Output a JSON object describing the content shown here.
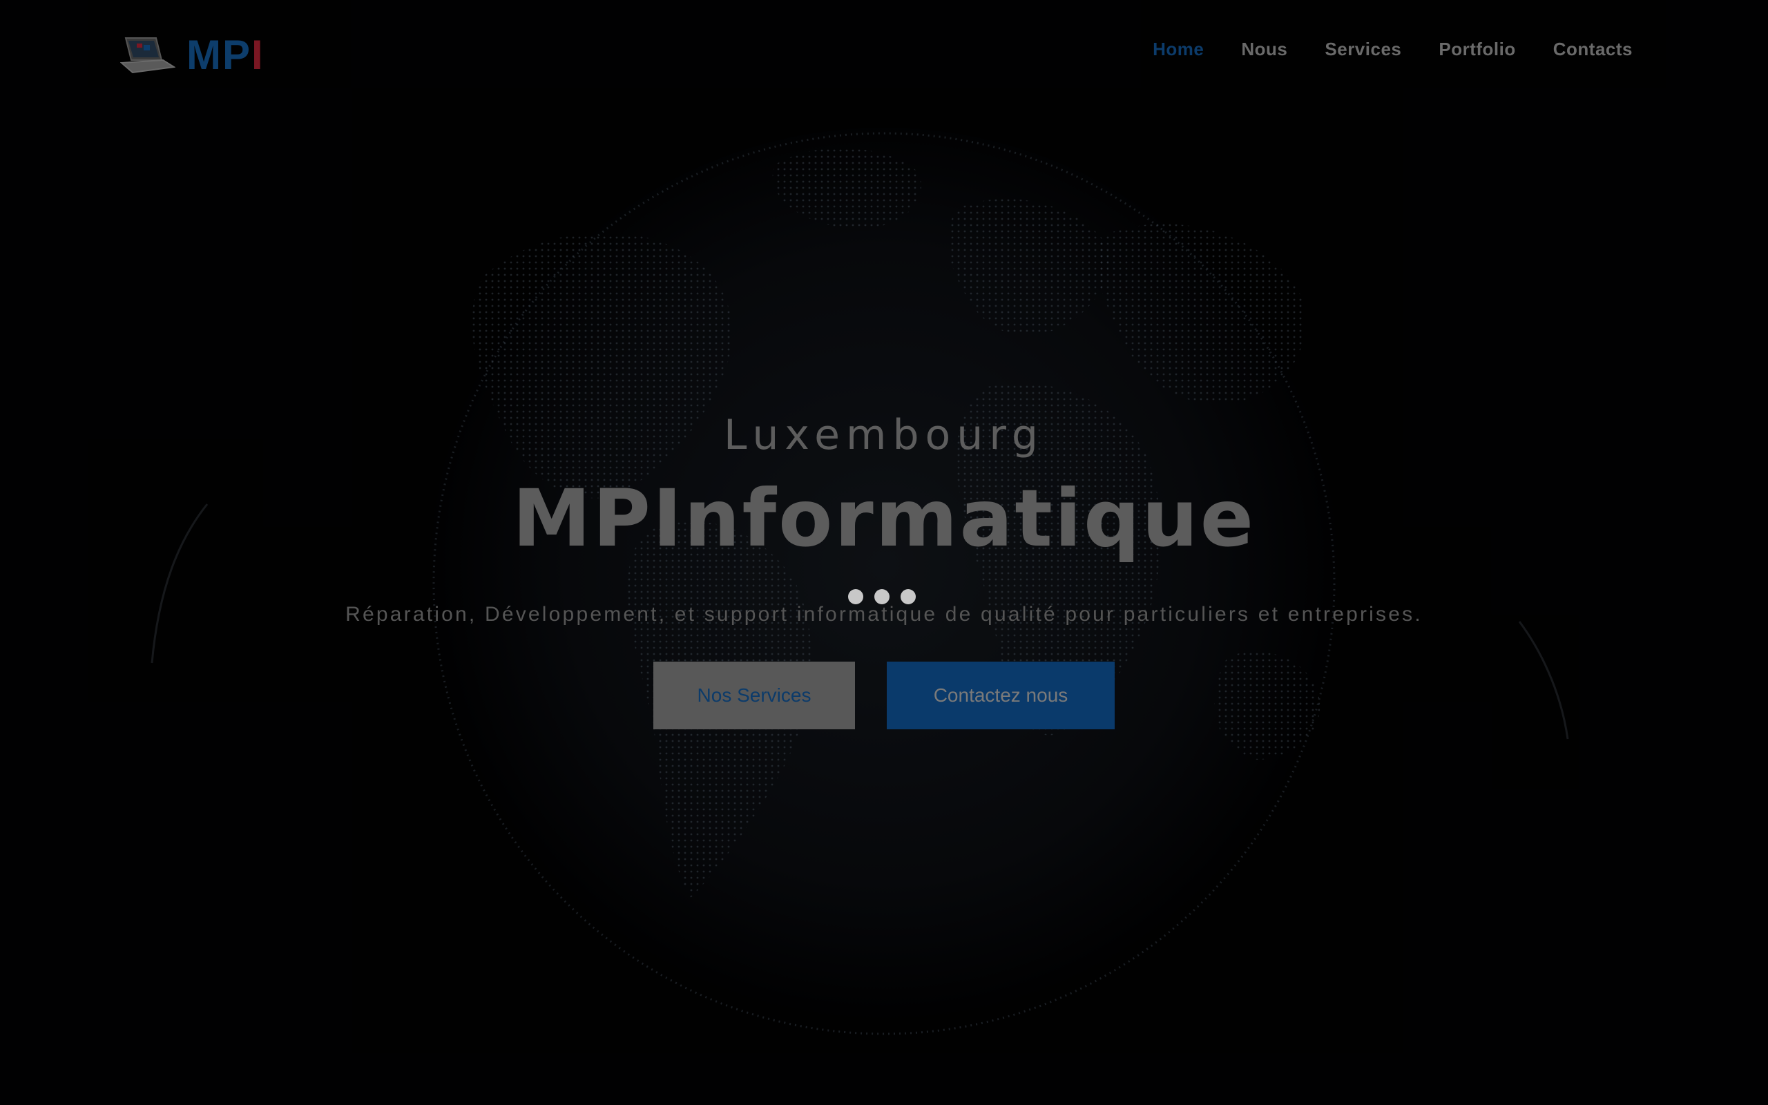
{
  "header": {
    "logo_text": "MP",
    "logo_text_accent": "I",
    "nav": [
      {
        "label": "Home",
        "active": true
      },
      {
        "label": "Nous",
        "active": false
      },
      {
        "label": "Services",
        "active": false
      },
      {
        "label": "Portfolio",
        "active": false
      },
      {
        "label": "Contacts",
        "active": false
      }
    ]
  },
  "hero": {
    "kicker": "Luxembourg",
    "title": "MPInformatique",
    "subtitle": "Réparation, Développement, et support informatique de qualité pour particuliers et entreprises.",
    "buttons": {
      "services": "Nos Services",
      "contact": "Contactez nous"
    }
  },
  "colors": {
    "brand_blue": "#0c3b6a",
    "brand_red": "#7a1723",
    "background": "#020203"
  },
  "icons": {
    "logo": "laptop-icon",
    "loader": "loading-dots-icon",
    "background": "world-globe-image"
  }
}
